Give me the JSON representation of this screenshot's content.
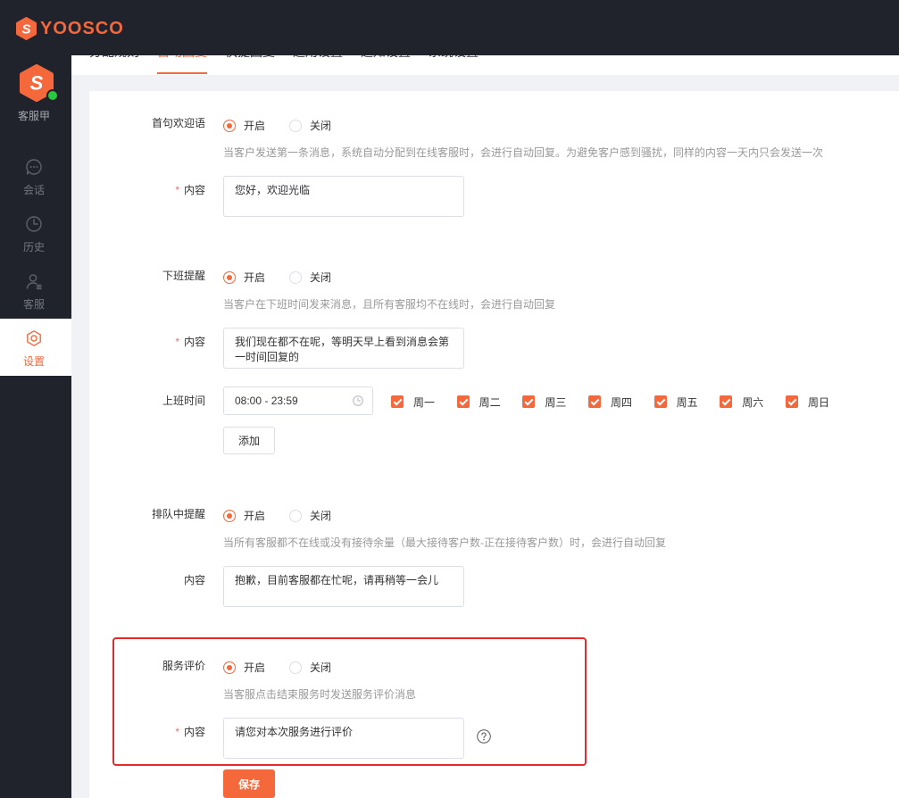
{
  "theme": {
    "accent": "#f4683c",
    "chrome": "#20232b",
    "page_bg": "#f0f2f5",
    "highlight": "#e42a2a",
    "online": "#27c93f"
  },
  "header": {
    "logo_icon": "hexagon-logo-icon",
    "logo_letter": "S",
    "brand_name": "YOOSCO"
  },
  "sidebar": {
    "agent": {
      "avatar_letter": "S",
      "name": "客服甲",
      "online": true
    },
    "items": [
      {
        "label": "会话",
        "icon": "chat-icon",
        "active": false
      },
      {
        "label": "历史",
        "icon": "clock-icon",
        "active": false
      },
      {
        "label": "客服",
        "icon": "agent-icon",
        "active": false
      },
      {
        "label": "设置",
        "icon": "settings-icon",
        "active": true
      }
    ]
  },
  "tabs": [
    {
      "label": "分配规则",
      "active": false
    },
    {
      "label": "自动回复",
      "active": true
    },
    {
      "label": "快捷回复",
      "active": false
    },
    {
      "label": "通用设置",
      "active": false
    },
    {
      "label": "通知设置",
      "active": false
    },
    {
      "label": "系统设置",
      "active": false
    }
  ],
  "form": {
    "welcome": {
      "label": "首句欢迎语",
      "enabled": true,
      "on_label": "开启",
      "off_label": "关闭",
      "description": "当客户发送第一条消息，系统自动分配到在线客服时，会进行自动回复。为避免客户感到骚扰，同样的内容一天内只会发送一次",
      "content_label": "内容",
      "content_required": true,
      "content": "您好，欢迎光临"
    },
    "offline": {
      "label": "下班提醒",
      "enabled": true,
      "on_label": "开启",
      "off_label": "关闭",
      "description": "当客户在下班时间发来消息，且所有客服均不在线时，会进行自动回复",
      "content_label": "内容",
      "content_required": true,
      "content": "我们现在都不在呢，等明天早上看到消息会第一时间回复的",
      "work_time": {
        "label": "上班时间",
        "value": "08:00 - 23:59",
        "icon": "clock-icon",
        "days": [
          {
            "label": "周一",
            "checked": true
          },
          {
            "label": "周二",
            "checked": true
          },
          {
            "label": "周三",
            "checked": true
          },
          {
            "label": "周四",
            "checked": true
          },
          {
            "label": "周五",
            "checked": true
          },
          {
            "label": "周六",
            "checked": true
          },
          {
            "label": "周日",
            "checked": true
          }
        ],
        "add_label": "添加"
      }
    },
    "queue": {
      "label": "排队中提醒",
      "enabled": true,
      "on_label": "开启",
      "off_label": "关闭",
      "description": "当所有客服都不在线或没有接待余量（最大接待客户数-正在接待客户数）时，会进行自动回复",
      "content_label": "内容",
      "content_required": false,
      "content": "抱歉，目前客服都在忙呢，请再稍等一会儿"
    },
    "rating": {
      "label": "服务评价",
      "enabled": true,
      "on_label": "开启",
      "off_label": "关闭",
      "description": "当客服点击结束服务时发送服务评价消息",
      "content_label": "内容",
      "content_required": true,
      "content": "请您对本次服务进行评价",
      "help_icon": "question-circle-icon"
    },
    "save_label": "保存"
  }
}
